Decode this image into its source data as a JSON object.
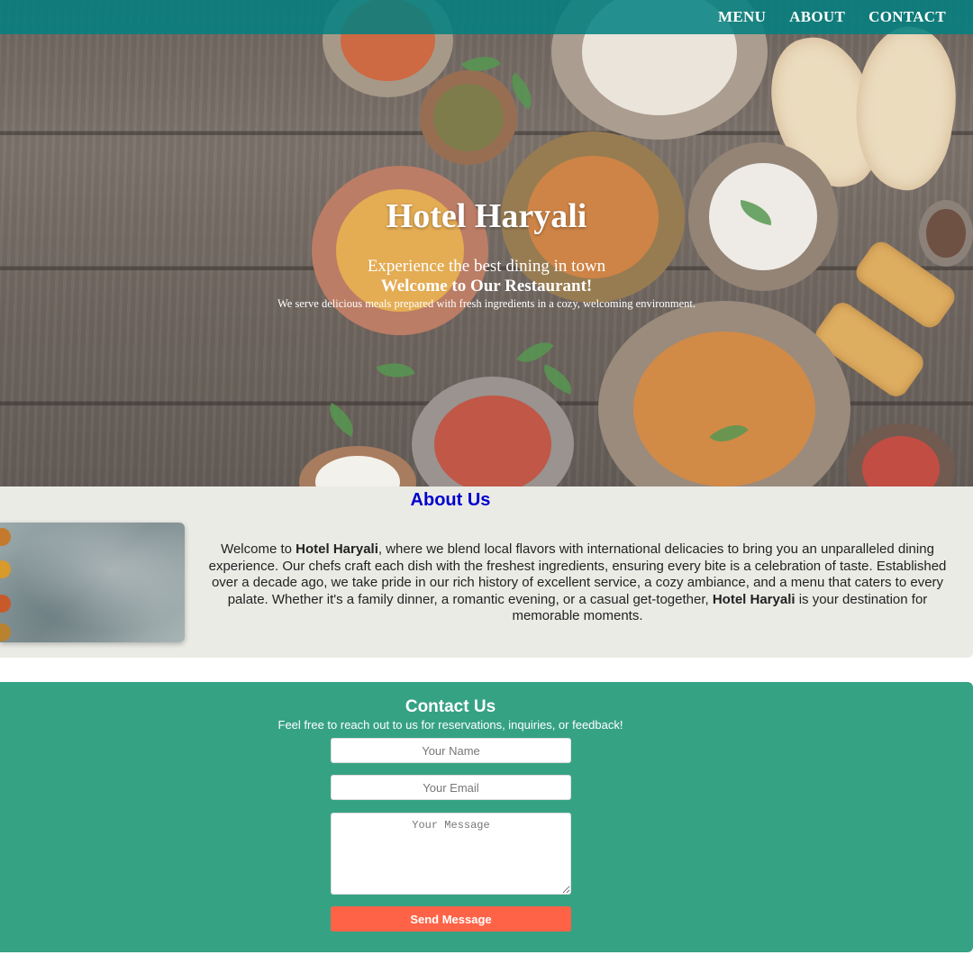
{
  "nav": {
    "items": [
      {
        "label": "MENU"
      },
      {
        "label": "ABOUT"
      },
      {
        "label": "CONTACT"
      }
    ]
  },
  "hero": {
    "title": "Hotel Haryali",
    "tagline": "Experience the best dining in town",
    "welcome": "Welcome to Our Restaurant!",
    "description": "We serve delicious meals prepared with fresh ingredients in a cozy, welcoming environment."
  },
  "about": {
    "title": "About Us",
    "text": {
      "p1": "Welcome to ",
      "brand1": "Hotel Haryali",
      "p2": ", where we blend local flavors with international delicacies to bring you an unparalleled dining experience. Our chefs craft each dish with the freshest ingredients, ensuring every bite is a celebration of taste. Established over a decade ago, we take pride in our rich history of excellent service, a cozy ambiance, and a menu that caters to every palate. Whether it's a family dinner, a romantic evening, or a casual get-together, ",
      "brand2": "Hotel Haryali",
      "p3": " is your destination for memorable moments."
    }
  },
  "contact": {
    "title": "Contact Us",
    "subtitle": "Feel free to reach out to us for reservations, inquiries, or feedback!",
    "name_placeholder": "Your Name",
    "email_placeholder": "Your Email",
    "message_placeholder": "Your Message",
    "send_label": "Send Message"
  },
  "colors": {
    "nav_bg": "#008080",
    "about_title": "#0000cd",
    "about_bg": "#ebebe6",
    "contact_bg": "#36a284",
    "send_button": "#ff6347"
  }
}
